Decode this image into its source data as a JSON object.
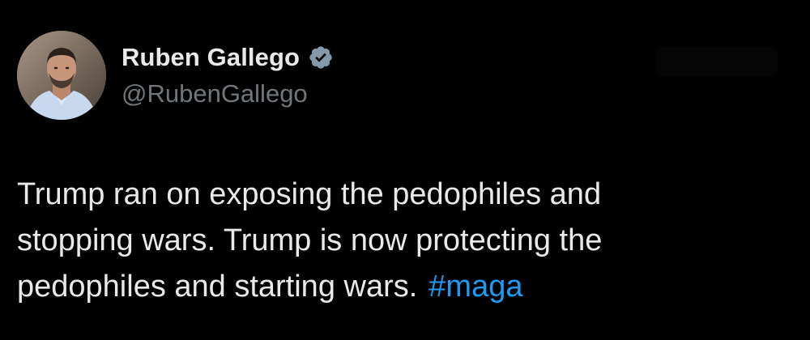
{
  "author": {
    "display_name": "Ruben Gallego",
    "handle": "@RubenGallego",
    "verified_icon": "verified-badge-icon",
    "avatar_icon": "avatar-photo"
  },
  "tweet": {
    "lines": [
      "Trump ran on exposing the pedophiles and",
      "stopping wars. Trump is now protecting the",
      "pedophiles and starting wars."
    ],
    "hashtag": "#maga"
  },
  "colors": {
    "background": "#000000",
    "text": "#e7e9ea",
    "secondary_text": "#71767b",
    "link": "#1d9bf0",
    "verified_badge": "#829aab"
  }
}
